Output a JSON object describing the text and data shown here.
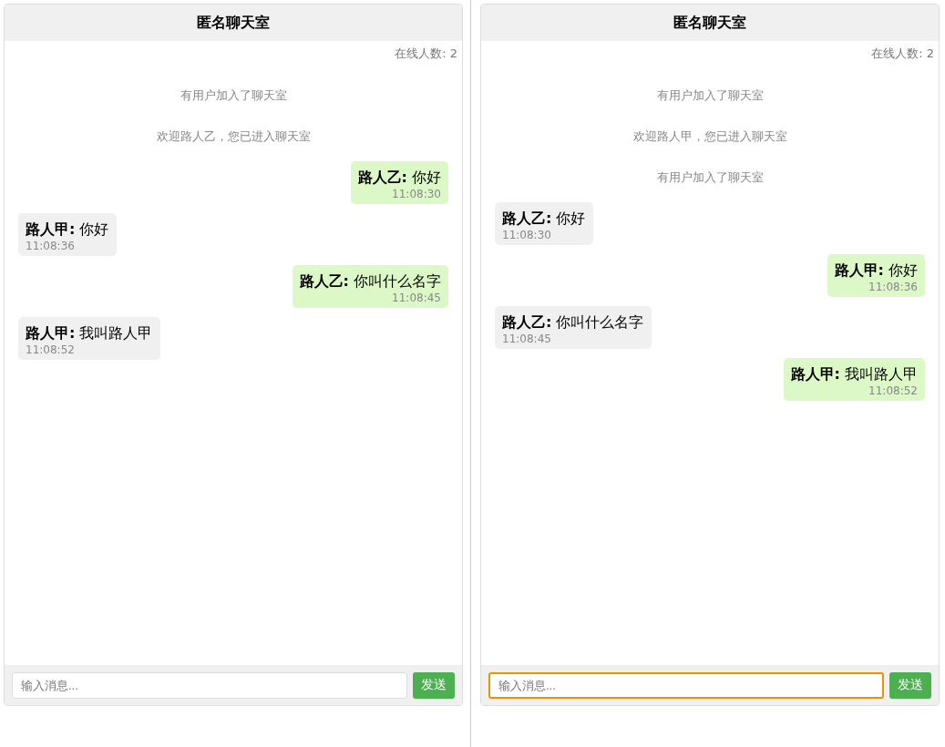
{
  "panes": [
    {
      "title": "匿名聊天室",
      "online": "在线人数: 2",
      "messages": [
        {
          "kind": "system",
          "text": "有用户加入了聊天室"
        },
        {
          "kind": "system",
          "text": "欢迎路人乙，您已进入聊天室"
        },
        {
          "kind": "message",
          "mine": true,
          "text": "**路人乙:** 你好",
          "time": "11:08:30"
        },
        {
          "kind": "message",
          "mine": false,
          "text": "**路人甲:** 你好",
          "time": "11:08:36"
        },
        {
          "kind": "message",
          "mine": true,
          "text": "**路人乙:** 你叫什么名字",
          "time": "11:08:45"
        },
        {
          "kind": "message",
          "mine": false,
          "text": "**路人甲:** 我叫路人甲",
          "time": "11:08:52"
        }
      ],
      "input": {
        "placeholder": "输入消息...",
        "focused": false
      },
      "send": "发送"
    },
    {
      "title": "匿名聊天室",
      "online": "在线人数: 2",
      "messages": [
        {
          "kind": "system",
          "text": "有用户加入了聊天室"
        },
        {
          "kind": "system",
          "text": "欢迎路人甲，您已进入聊天室"
        },
        {
          "kind": "system",
          "text": "有用户加入了聊天室"
        },
        {
          "kind": "message",
          "mine": false,
          "text": "**路人乙:** 你好",
          "time": "11:08:30"
        },
        {
          "kind": "message",
          "mine": true,
          "text": "**路人甲:** 你好",
          "time": "11:08:36"
        },
        {
          "kind": "message",
          "mine": false,
          "text": "**路人乙:** 你叫什么名字",
          "time": "11:08:45"
        },
        {
          "kind": "message",
          "mine": true,
          "text": "**路人甲:** 我叫路人甲",
          "time": "11:08:52"
        }
      ],
      "input": {
        "placeholder": "输入消息...",
        "focused": true
      },
      "send": "发送"
    }
  ]
}
